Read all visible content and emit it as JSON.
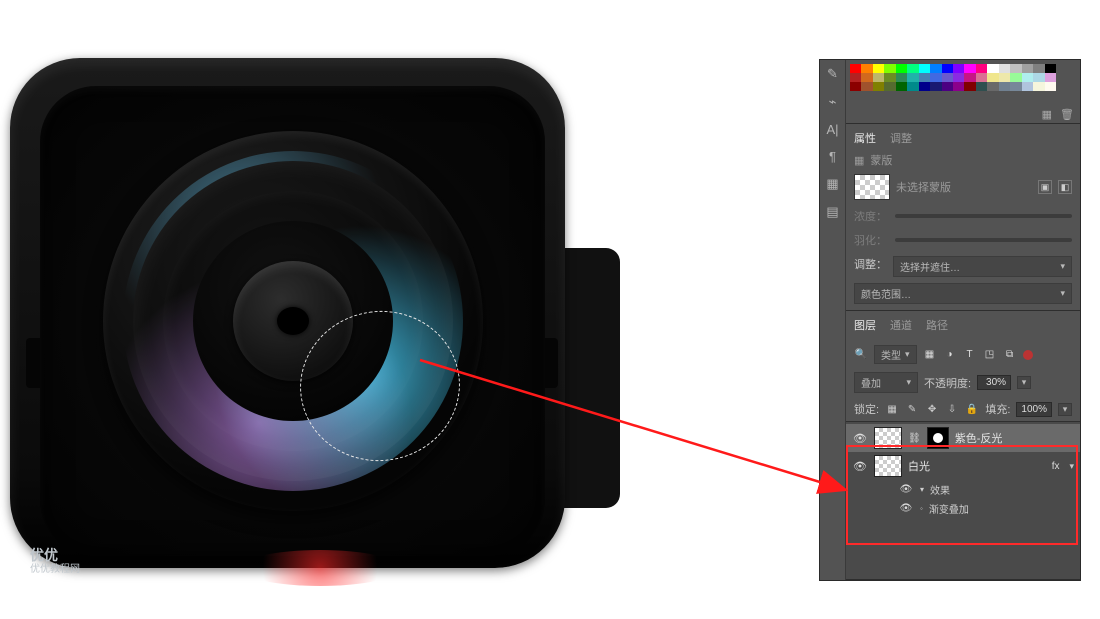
{
  "watermark": {
    "line1": "优优",
    "line2": "优优教程网"
  },
  "swatches_colors": [
    "#ff0000",
    "#ff7f00",
    "#ffff00",
    "#7fff00",
    "#00ff00",
    "#00ff7f",
    "#00ffff",
    "#007fff",
    "#0000ff",
    "#7f00ff",
    "#ff00ff",
    "#ff007f",
    "#ffffff",
    "#e0e0e0",
    "#c0c0c0",
    "#a0a0a0",
    "#808080",
    "#000000",
    "#b22222",
    "#d2691e",
    "#bdb76b",
    "#6b8e23",
    "#2e8b57",
    "#20b2aa",
    "#4682b4",
    "#4169e1",
    "#6a5acd",
    "#8a2be2",
    "#c71585",
    "#db7093",
    "#f0e68c",
    "#eee8aa",
    "#98fb98",
    "#afeeee",
    "#add8e6",
    "#dda0dd",
    "#8b0000",
    "#a0522d",
    "#808000",
    "#556b2f",
    "#006400",
    "#008b8b",
    "#00008b",
    "#191970",
    "#4b0082",
    "#8b008b",
    "#800000",
    "#2f4f4f",
    "#696969",
    "#708090",
    "#778899",
    "#b0c4de",
    "#f5f5dc",
    "#fffaf0"
  ],
  "swatch_footer": {
    "new": "▦",
    "trash": "🗑"
  },
  "rail_icons": [
    "✎",
    "⌁",
    "A|",
    "¶",
    "▦",
    "▤"
  ],
  "properties": {
    "tab_props": "属性",
    "tab_adjust": "调整",
    "mask_icon": "▦",
    "mask_label": "蒙版",
    "no_mask_selected": "未选择蒙版",
    "clip_icon_a": "▣",
    "clip_icon_b": "◧",
    "density_label": "浓度：",
    "feather_label": "羽化：",
    "refine_label": "调整：",
    "refine_btn": "选择并遮住…",
    "color_range_btn": "颜色范围…"
  },
  "layers_panel": {
    "tab_layers": "图层",
    "tab_channels": "通道",
    "tab_paths": "路径",
    "filter_kind": "类型",
    "search_icon": "🔍",
    "filter_icons": [
      "▦",
      "◑",
      "T",
      "◳",
      "⧉"
    ],
    "blend_mode": "叠加",
    "opacity_label": "不透明度:",
    "opacity_value": "30%",
    "lock_label": "锁定:",
    "lock_icons": [
      "▦",
      "✎",
      "✥",
      "⇩",
      "🔒"
    ],
    "fill_label": "填充:",
    "fill_value": "100%",
    "layers": [
      {
        "visible": true,
        "linked": true,
        "masked": true,
        "name": "紫色-反光",
        "selected": true
      },
      {
        "visible": true,
        "linked": false,
        "masked": false,
        "name": "白光",
        "selected": false,
        "fx": "fx"
      }
    ],
    "effects_label": "效果",
    "effect_item": "渐变叠加"
  }
}
